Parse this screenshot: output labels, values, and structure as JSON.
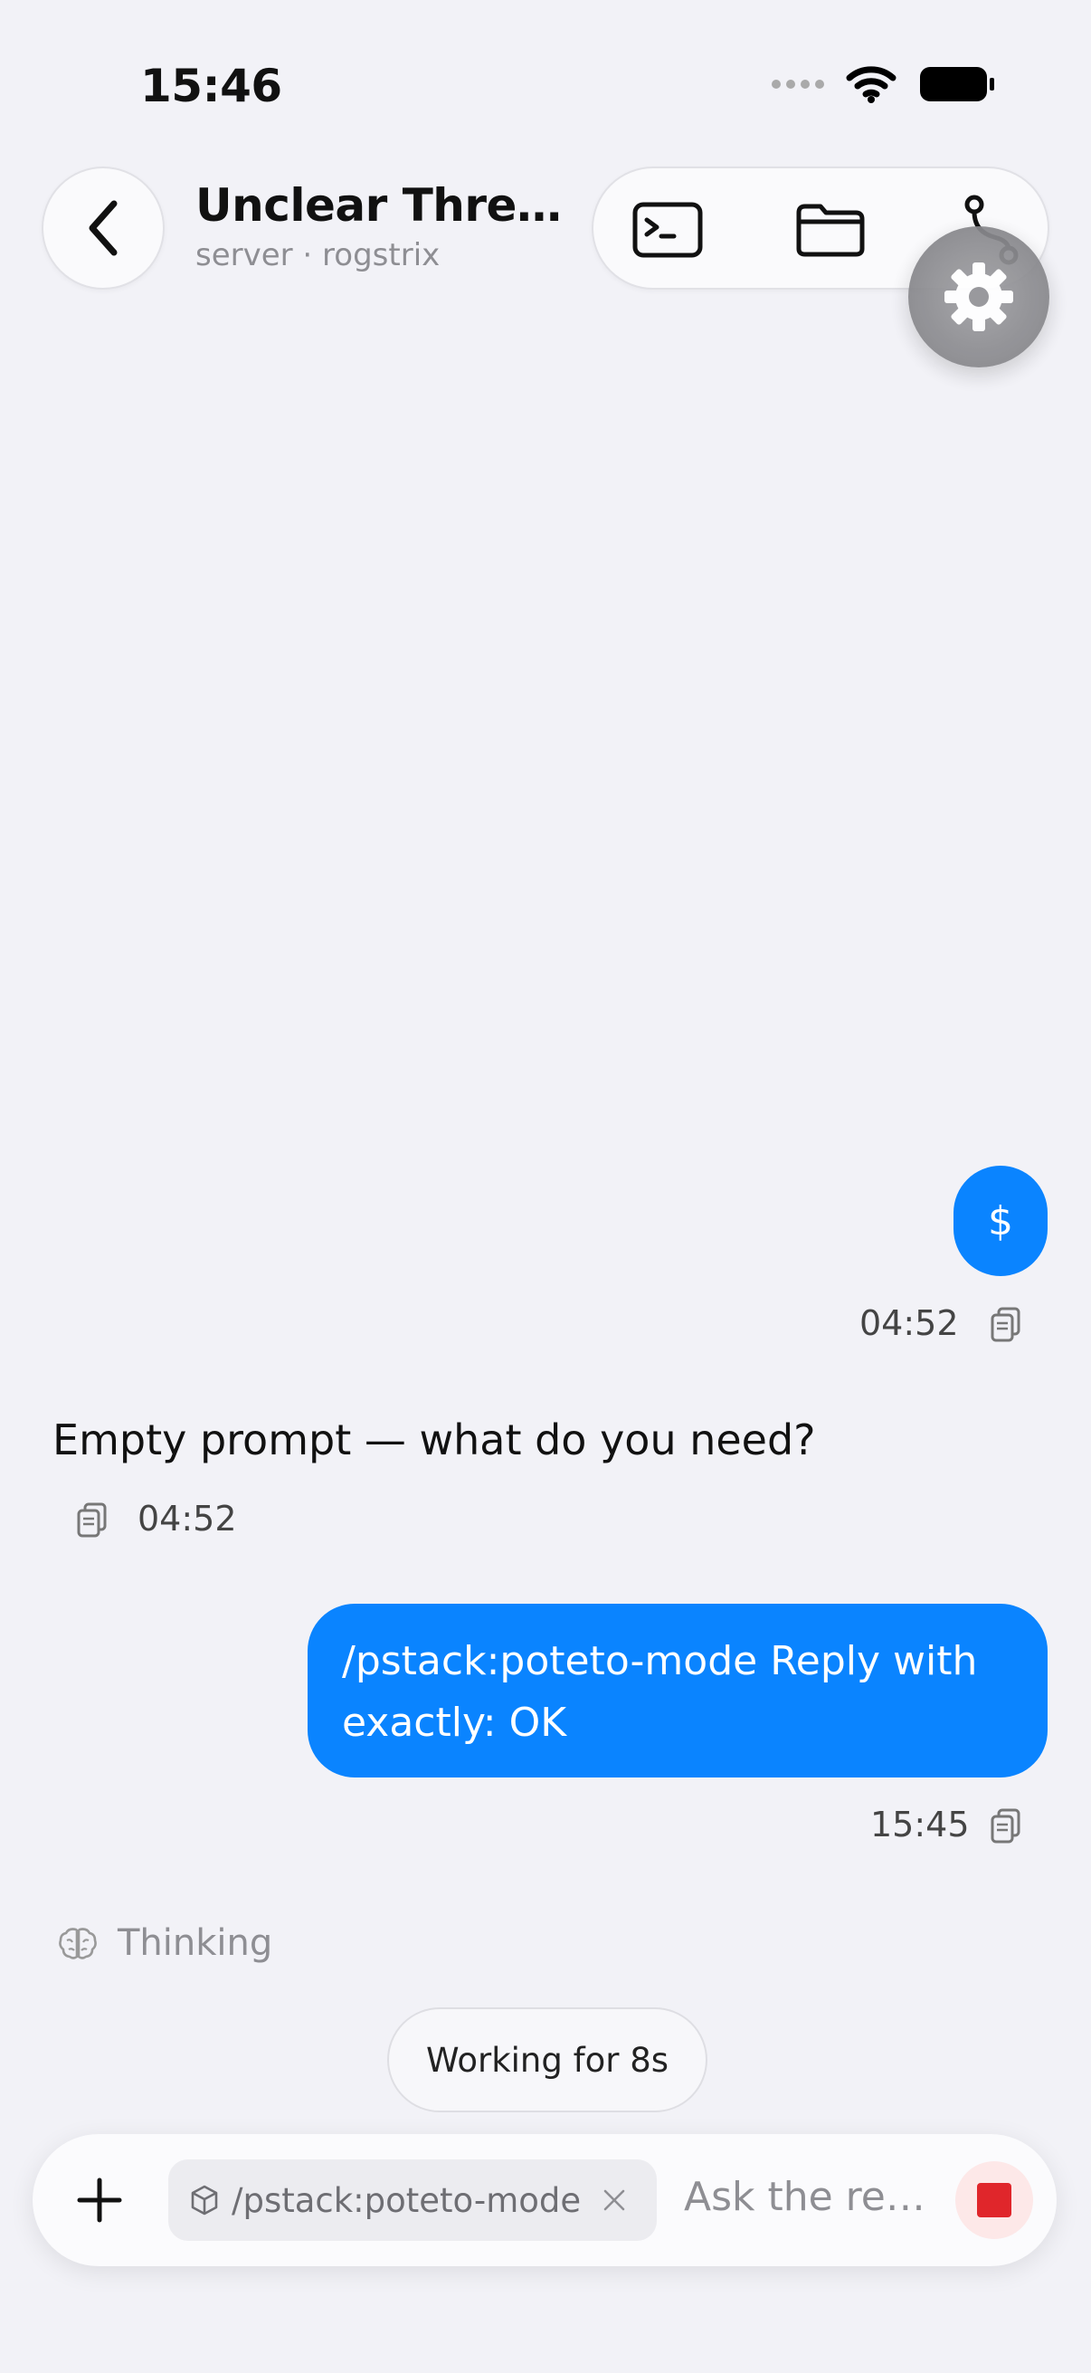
{
  "status_bar": {
    "time": "15:46"
  },
  "header": {
    "title": "Unclear Thre…",
    "subtitle": "server · rogstrix",
    "toolbar": [
      "terminal-icon",
      "folder-icon",
      "git-branch-icon"
    ],
    "settings_icon": "gear-icon"
  },
  "messages": [
    {
      "role": "user",
      "text": "$",
      "time": "04:52"
    },
    {
      "role": "assistant",
      "text": "Empty prompt — what do you need?",
      "time": "04:52"
    },
    {
      "role": "user",
      "text": "/pstack:poteto-mode Reply with exactly: OK",
      "time": "15:45"
    }
  ],
  "thinking": {
    "label": "Thinking"
  },
  "working": {
    "label": "Working for 8s"
  },
  "composer": {
    "chip_label": "/pstack:poteto-mode",
    "placeholder": "Ask the re…"
  },
  "colors": {
    "accent": "#0a84ff",
    "stop": "#e0262b",
    "background": "#f2f2f7"
  }
}
